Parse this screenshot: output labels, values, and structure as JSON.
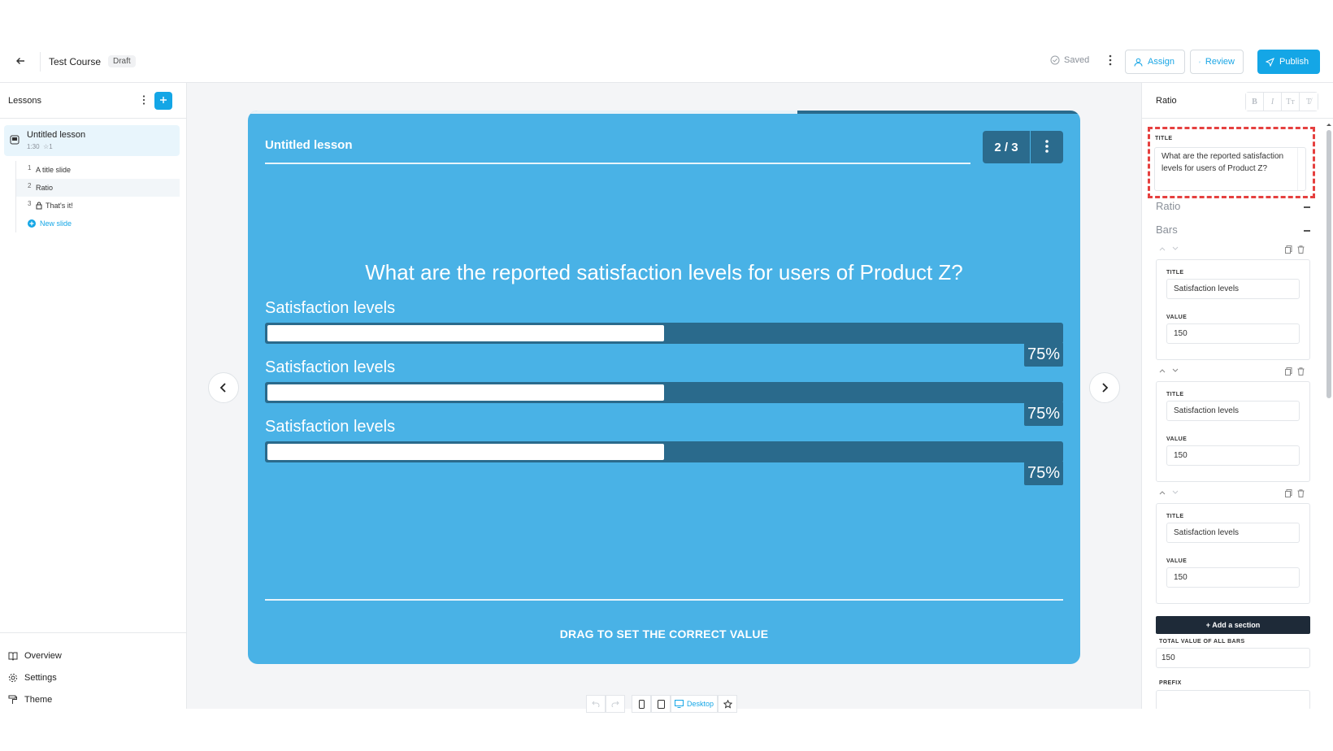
{
  "header": {
    "course_title": "Test Course",
    "status_badge": "Draft",
    "saved_label": "Saved",
    "assign_label": "Assign",
    "review_label": "Review",
    "publish_label": "Publish"
  },
  "sidebar": {
    "title": "Lessons",
    "lesson": {
      "name": "Untitled lesson",
      "duration": "1:30",
      "stars": "1"
    },
    "slides": [
      {
        "num": "1",
        "label": "A title slide"
      },
      {
        "num": "2",
        "label": "Ratio"
      },
      {
        "num": "3",
        "label": "That's it!"
      }
    ],
    "new_slide_label": "New slide",
    "bottom_links": [
      "Overview",
      "Settings",
      "Theme"
    ]
  },
  "slide": {
    "lesson_title": "Untitled lesson",
    "counter": "2 / 3",
    "progress_fraction": 0.66,
    "question": "What are the reported satisfaction levels for users of Product Z?",
    "bars": [
      {
        "title": "Satisfaction levels",
        "percent_label": "75%",
        "fill_fraction": 0.5
      },
      {
        "title": "Satisfaction levels",
        "percent_label": "75%",
        "fill_fraction": 0.5
      },
      {
        "title": "Satisfaction levels",
        "percent_label": "75%",
        "fill_fraction": 0.5
      }
    ],
    "footer": "DRAG TO SET THE CORRECT VALUE",
    "accent_color": "#49b2e6",
    "dark_color": "#2a6a8c"
  },
  "device_bar": {
    "desktop_label": "Desktop"
  },
  "right_panel": {
    "title": "Ratio",
    "title_field_label": "TITLE",
    "title_value": "What are the reported satisfaction levels for users of Product Z?",
    "section_ratio": "Ratio",
    "section_bars": "Bars",
    "bar_cards": [
      {
        "title_label": "TITLE",
        "title_value": "Satisfaction levels",
        "value_label": "VALUE",
        "value": "150"
      },
      {
        "title_label": "TITLE",
        "title_value": "Satisfaction levels",
        "value_label": "VALUE",
        "value": "150"
      },
      {
        "title_label": "TITLE",
        "title_value": "Satisfaction levels",
        "value_label": "VALUE",
        "value": "150"
      }
    ],
    "add_section_label": "+ Add a section",
    "total_label": "TOTAL VALUE OF ALL BARS",
    "total_value": "150",
    "prefix_label": "PREFIX",
    "prefix_value": ""
  }
}
